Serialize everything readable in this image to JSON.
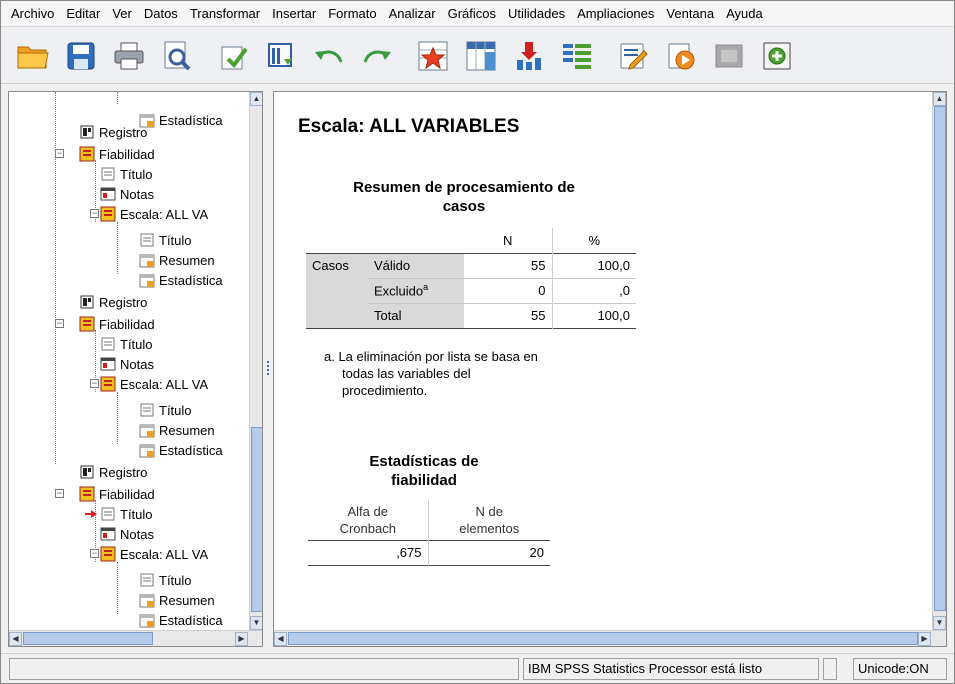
{
  "menu": [
    "Archivo",
    "Editar",
    "Ver",
    "Datos",
    "Transformar",
    "Insertar",
    "Formato",
    "Analizar",
    "Gráficos",
    "Utilidades",
    "Ampliaciones",
    "Ventana",
    "Ayuda"
  ],
  "toolbar": [
    "open-icon",
    "save-icon",
    "print-icon",
    "print-preview-icon",
    "export-icon",
    "goto-data-icon",
    "undo-icon",
    "redo-icon",
    "goto-case-icon",
    "goto-variable-icon",
    "insert-variable-icon",
    "insert-cases-icon",
    "edit-output-icon",
    "play-icon",
    "disabled-pane-icon",
    "designate-window-icon"
  ],
  "tree": {
    "items": [
      {
        "label": "Estadística"
      },
      {
        "label": "Registro"
      },
      {
        "label": "Fiabilidad"
      },
      {
        "label": "Título"
      },
      {
        "label": "Notas"
      },
      {
        "label": "Escala: ALL VA"
      },
      {
        "label": "Título"
      },
      {
        "label": "Resumen"
      },
      {
        "label": "Estadística"
      },
      {
        "label": "Registro"
      },
      {
        "label": "Fiabilidad"
      },
      {
        "label": "Título"
      },
      {
        "label": "Notas"
      },
      {
        "label": "Escala: ALL VA"
      },
      {
        "label": "Título"
      },
      {
        "label": "Resumen"
      },
      {
        "label": "Estadística"
      },
      {
        "label": "Registro"
      },
      {
        "label": "Fiabilidad"
      },
      {
        "label": "Título"
      },
      {
        "label": "Notas"
      },
      {
        "label": "Escala: ALL VA"
      },
      {
        "label": "Título"
      },
      {
        "label": "Resumen"
      },
      {
        "label": "Estadística"
      }
    ]
  },
  "output": {
    "heading": "Escala: ALL VARIABLES",
    "summary": {
      "title_line1": "Resumen de procesamiento de",
      "title_line2": "casos",
      "col_n": "N",
      "col_pct": "%",
      "group": "Casos",
      "rows": [
        {
          "label": "Válido",
          "n": "55",
          "pct": "100,0"
        },
        {
          "label": "Excluido",
          "sup": "a",
          "n": "0",
          "pct": ",0"
        },
        {
          "label": "Total",
          "n": "55",
          "pct": "100,0"
        }
      ],
      "footnote_line1": "a. La eliminación por lista se basa en",
      "footnote_line2": "todas las variables del",
      "footnote_line3": "procedimiento."
    },
    "reliability": {
      "title_line1": "Estadísticas de",
      "title_line2": "fiabilidad",
      "col1_line1": "Alfa de",
      "col1_line2": "Cronbach",
      "col2_line1": "N de",
      "col2_line2": "elementos",
      "alpha": ",675",
      "n_items": "20"
    }
  },
  "status": {
    "processor": "IBM SPSS Statistics Processor está listo",
    "encoding": "Unicode:ON"
  },
  "colors": {
    "table_label_bg": "#d9d9d9",
    "scroll_thumb": "#b4ccea",
    "selection_arrow": "#e02020"
  }
}
